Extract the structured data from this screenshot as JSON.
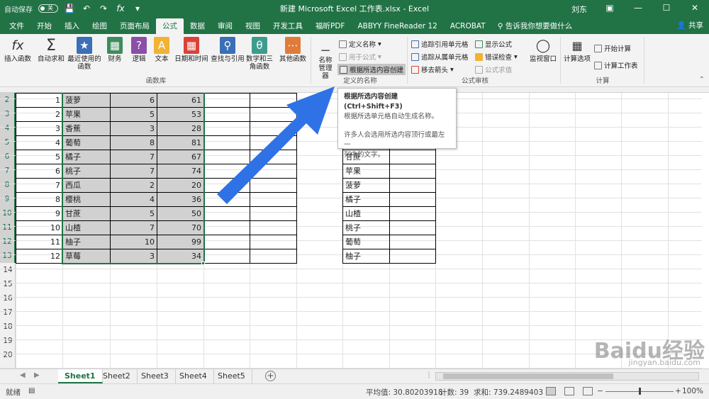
{
  "window": {
    "autosave_label": "自动保存",
    "autosave_state": "关",
    "title": "新建 Microsoft Excel 工作表.xlsx  -  Excel",
    "user": "刘东"
  },
  "tabs": [
    "文件",
    "开始",
    "插入",
    "绘图",
    "页面布局",
    "公式",
    "数据",
    "审阅",
    "视图",
    "开发工具",
    "福昕PDF",
    "ABBYY FineReader 12",
    "ACROBAT"
  ],
  "active_tab": "公式",
  "tell_me": "告诉我你想要做什么",
  "share": "共享",
  "ribbon": {
    "function_library": {
      "label": "函数库",
      "buttons": [
        "插入函数",
        "自动求和",
        "最近使用的函数",
        "财务",
        "逻辑",
        "文本",
        "日期和时间",
        "查找与引用",
        "数学和三角函数",
        "其他函数"
      ]
    },
    "defined_names": {
      "label": "定义的名称",
      "manager": "名称管理器",
      "define_name": "定义名称",
      "use_in_formula": "用于公式",
      "create_from_selection": "根据所选内容创建"
    },
    "formula_auditing": {
      "label": "公式审核",
      "trace_precedents": "追踪引用单元格",
      "trace_dependents": "追踪从属单元格",
      "remove_arrows": "移去箭头",
      "show_formulas": "显示公式",
      "error_checking": "错误检查",
      "evaluate_formula": "公式求值",
      "watch_window": "监视窗口"
    },
    "calculation": {
      "label": "计算",
      "options": "计算选项",
      "calc_now": "开始计算",
      "calc_sheet": "计算工作表"
    }
  },
  "tooltip": {
    "title": "根据所选内容创建 (Ctrl+Shift+F3)",
    "line1": "根据所选单元格自动生成名称。",
    "line2": "许多人会选用所选内容顶行或最左一",
    "line3": "列中的文字。"
  },
  "row_numbers": [
    "2",
    "3",
    "4",
    "5",
    "6",
    "7",
    "8",
    "9",
    "10",
    "11",
    "12",
    "13",
    "14",
    "15",
    "16",
    "17",
    "18",
    "19",
    "20"
  ],
  "table": [
    {
      "n": "1",
      "name": "菠萝",
      "a": "6",
      "b": "61"
    },
    {
      "n": "2",
      "name": "苹果",
      "a": "5",
      "b": "53"
    },
    {
      "n": "3",
      "name": "香蕉",
      "a": "3",
      "b": "28"
    },
    {
      "n": "4",
      "name": "葡萄",
      "a": "8",
      "b": "81"
    },
    {
      "n": "5",
      "name": "橘子",
      "a": "7",
      "b": "67"
    },
    {
      "n": "6",
      "name": "桃子",
      "a": "7",
      "b": "74"
    },
    {
      "n": "7",
      "name": "西瓜",
      "a": "2",
      "b": "20"
    },
    {
      "n": "8",
      "name": "樱桃",
      "a": "4",
      "b": "36"
    },
    {
      "n": "9",
      "name": "甘蔗",
      "a": "5",
      "b": "50"
    },
    {
      "n": "10",
      "name": "山楂",
      "a": "7",
      "b": "70"
    },
    {
      "n": "11",
      "name": "柚子",
      "a": "10",
      "b": "99"
    },
    {
      "n": "12",
      "name": "草莓",
      "a": "3",
      "b": "34"
    }
  ],
  "right_list": [
    "甘蔗",
    "苹果",
    "菠萝",
    "橘子",
    "山楂",
    "桃子",
    "葡萄",
    "柚子"
  ],
  "sheets": [
    "Sheet1",
    "Sheet2",
    "Sheet3",
    "Sheet4",
    "Sheet5"
  ],
  "active_sheet": "Sheet1",
  "status": {
    "mode": "就绪",
    "average": "平均值: 30.80203918",
    "count": "计数: 39",
    "sum": "求和: 739.2489403",
    "zoom": "100%"
  },
  "watermark": {
    "brand": "Baidu经验",
    "url": "jingyan.baidu.com"
  }
}
